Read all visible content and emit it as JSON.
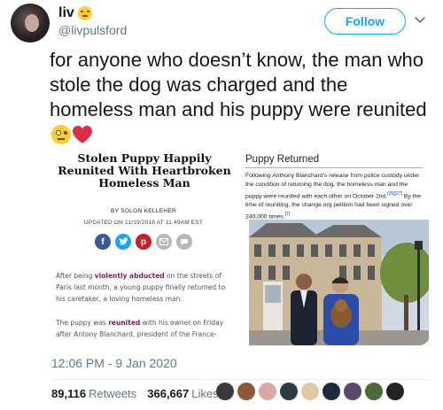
{
  "tweet": {
    "display_name": "liv",
    "handle": "@livpulsford",
    "follow_label": "Follow",
    "text": "for anyone who doesn’t know, the man who stole the dog was charged and the homeless man and his puppy were reunited",
    "timestamp": "12:06 PM - 9 Jan 2020",
    "retweets_count": "89,116",
    "retweets_label": "Retweets",
    "likes_count": "366,667",
    "likes_label": "Likes",
    "accent_color": "#1da1f2"
  },
  "article": {
    "title": "Stolen Puppy Happily Reunited With Heartbroken Homeless Man",
    "byline": "BY SOLON KELLEHER",
    "updated": "UPDATED ON 11/19/2018 AT 11:49AM EST",
    "para1_pre": "After being ",
    "para1_bold": "violently abducted",
    "para1_post": " on the streets of Paris last month, a young puppy finally returned to his caretaker, a loving homeless man.",
    "para2_pre": "The puppy was ",
    "para2_bold": "reunited",
    "para2_post": " with his owner on Friday after Antony Blanchard, president of the France-"
  },
  "wiki": {
    "heading": "Puppy Returned",
    "text_a": "Following Anthony Blanchard's release from police custody under the condition of returning the dog, the homeless man and the puppy were reunited with each other on October 2nd.",
    "ref_a": "[25][27]",
    "text_b": " By the time of reuniting, the change.org petition had been signed over 240,000 times.",
    "ref_b": "[7]"
  },
  "icons": {
    "avatar": "profile-photo",
    "name_emoji": "grinning-face-emoji",
    "chevron": "chevron-down-icon",
    "text_emoji": "face-with-rolling-eyes-emoji",
    "heart": "red-heart-emoji",
    "share_icons": [
      "facebook-icon",
      "twitter-icon",
      "pinterest-icon",
      "email-icon",
      "comment-icon"
    ]
  }
}
